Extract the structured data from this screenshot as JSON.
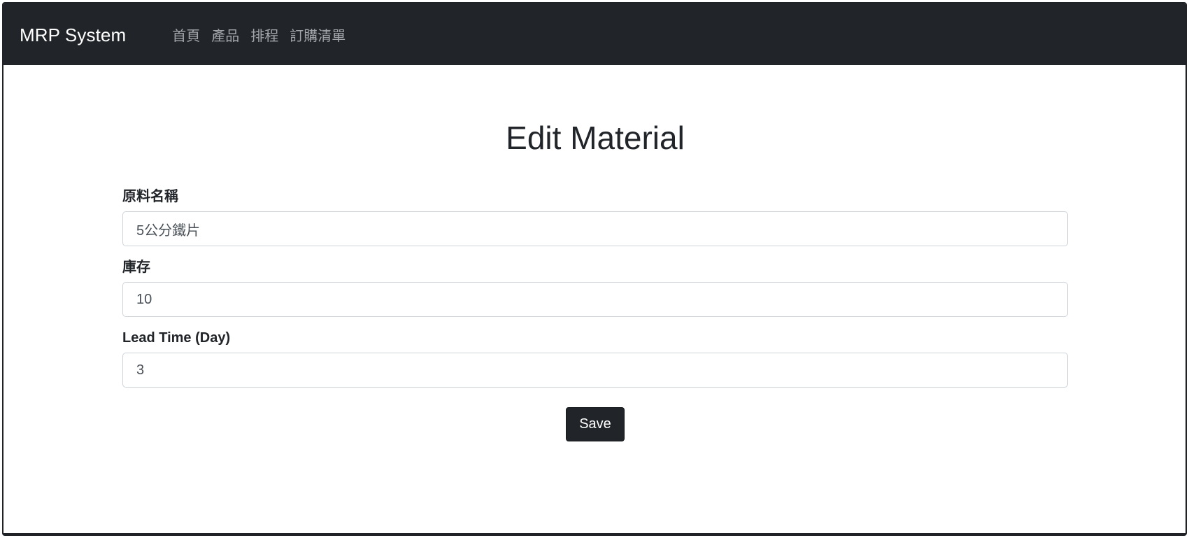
{
  "navbar": {
    "brand": "MRP System",
    "links": [
      {
        "label": "首頁"
      },
      {
        "label": "產品"
      },
      {
        "label": "排程"
      },
      {
        "label": "訂購清單"
      }
    ]
  },
  "page": {
    "title": "Edit Material"
  },
  "form": {
    "material_name": {
      "label": "原料名稱",
      "value": "5公分鐵片"
    },
    "stock": {
      "label": "庫存",
      "value": "10"
    },
    "lead_time": {
      "label": "Lead Time (Day)",
      "value": "3"
    },
    "save_label": "Save"
  },
  "colors": {
    "navbar_bg": "#212529",
    "button_bg": "#212529"
  }
}
